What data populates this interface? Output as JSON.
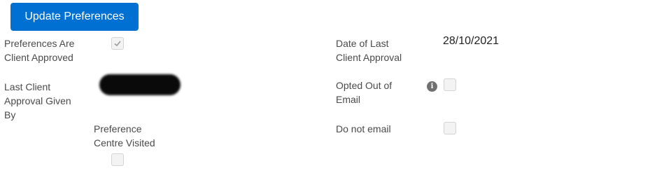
{
  "update_button_label": "Update Preferences",
  "fields": {
    "preferences_approved": {
      "label": "Preferences Are Client Approved",
      "checked": true
    },
    "date_last_approval": {
      "label": "Date of Last Client Approval",
      "value": "28/10/2021"
    },
    "last_approval_by": {
      "label": "Last Client Approval Given By"
    },
    "opted_out_email": {
      "label": "Opted Out of Email",
      "checked": false,
      "help_icon": "info-icon"
    },
    "preference_centre_visited": {
      "label": "Preference Centre Visited",
      "checked": false
    },
    "do_not_email": {
      "label": "Do not email",
      "checked": false
    }
  },
  "colors": {
    "accent": "#0070d2",
    "checkbox_bg": "#f3f3f3",
    "checkbox_border": "#d4d4d4"
  }
}
